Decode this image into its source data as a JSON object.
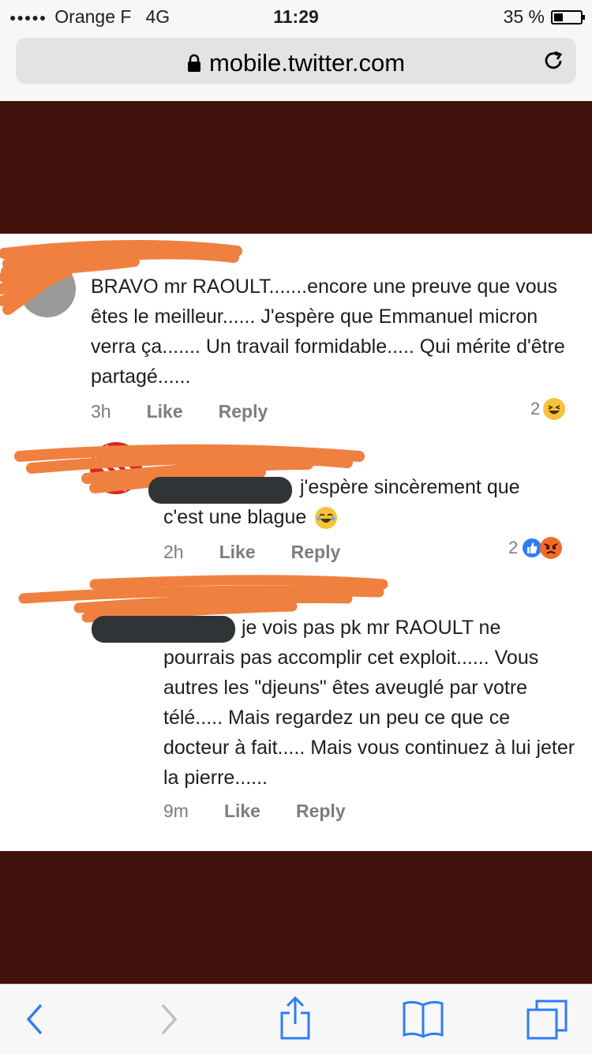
{
  "status": {
    "carrier": "Orange F",
    "network": "4G",
    "time": "11:29",
    "battery_text": "35 %",
    "battery_level": 0.35
  },
  "browser": {
    "url": "mobile.twitter.com"
  },
  "comments": [
    {
      "text": "BRAVO mr RAOULT.......encore une preuve que vous êtes le meilleur...... J'espère que Emmanuel micron verra ça....... Un travail formidable..... Qui mérite d'être partagé......",
      "time": "3h",
      "like": "Like",
      "reply": "Reply",
      "reaction_count": "2"
    },
    {
      "text_first": "j'espère sincèrement que",
      "text_rest": "c'est une blague",
      "time": "2h",
      "like": "Like",
      "reply": "Reply",
      "reaction_count": "2"
    },
    {
      "text_first": "je vois pas pk mr RAOULT ne",
      "text_rest": "pourrais pas accomplir cet exploit...... Vous autres les \"djeuns\" êtes aveuglé par votre télé..... Mais regardez un peu ce que ce docteur à fait..... Mais vous continuez à lui jeter la pierre......",
      "time": "9m",
      "like": "Like",
      "reply": "Reply"
    }
  ],
  "colors": {
    "band": "#41120c",
    "scribble": "#f08040",
    "redaction": "#303436",
    "ios_blue": "#2f7cf6"
  },
  "icons": [
    "lock-icon",
    "reload-icon",
    "back-icon",
    "forward-icon",
    "share-icon",
    "bookmarks-icon",
    "tabs-icon",
    "laughing-emoji-icon",
    "like-reaction-icon",
    "angry-emoji-icon"
  ]
}
